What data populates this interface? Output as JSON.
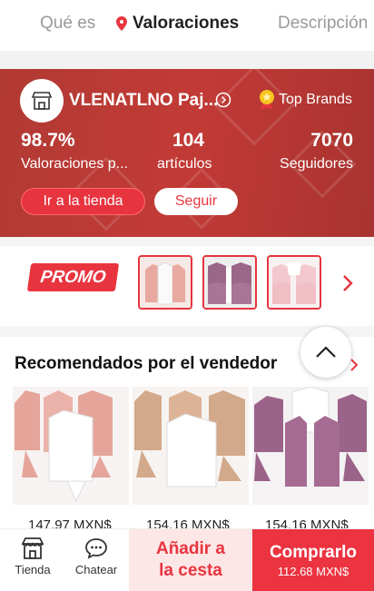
{
  "tabs": [
    "Qué es",
    "Valoraciones",
    "Descripción"
  ],
  "store": {
    "name": "VLENATLNO Paj...",
    "badge": "Top Brands",
    "stats": [
      {
        "value": "98.7%",
        "label": "Valoraciones p..."
      },
      {
        "value": "104",
        "label": "artículos"
      },
      {
        "value": "7070",
        "label": "Seguidores"
      }
    ],
    "visit_label": "Ir a la tienda",
    "follow_label": "Seguir"
  },
  "promo": {
    "label": "PROMO"
  },
  "recommended": {
    "title": "Recomendados por el vendedor",
    "products": [
      {
        "price": "147.97 MXN$"
      },
      {
        "price": "154.16 MXN$"
      },
      {
        "price": "154.16 MXN$"
      }
    ]
  },
  "bottom": {
    "store_label": "Tienda",
    "chat_label": "Chatear",
    "cart_label_1": "Añadir a",
    "cart_label_2": "la cesta",
    "buy_label": "Comprarlo",
    "buy_price": "112.68 MXN$"
  },
  "colors": {
    "accent": "#e8343f",
    "banner": "#b9372f"
  }
}
